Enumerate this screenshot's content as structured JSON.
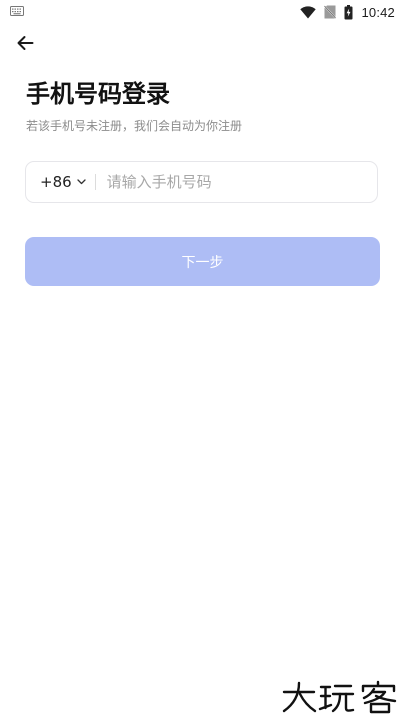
{
  "status_bar": {
    "time": "10:42",
    "icons": [
      "keyboard-icon",
      "wifi-icon",
      "no-sim-icon",
      "battery-icon"
    ]
  },
  "header": {
    "back_icon": "arrow-left-icon"
  },
  "login": {
    "title": "手机号码登录",
    "subtitle": "若该手机号未注册，我们会自动为你注册",
    "country_code": "+86",
    "country_chevron_icon": "chevron-down-icon",
    "phone_placeholder": "请输入手机号码",
    "phone_value": "",
    "next_label": "下一步"
  },
  "watermark": {
    "text": "大玩客"
  },
  "colors": {
    "button_disabled": "#aebdf5",
    "title": "#121212",
    "subtitle": "#8c8c8c",
    "field_border": "#e6e6ea"
  }
}
